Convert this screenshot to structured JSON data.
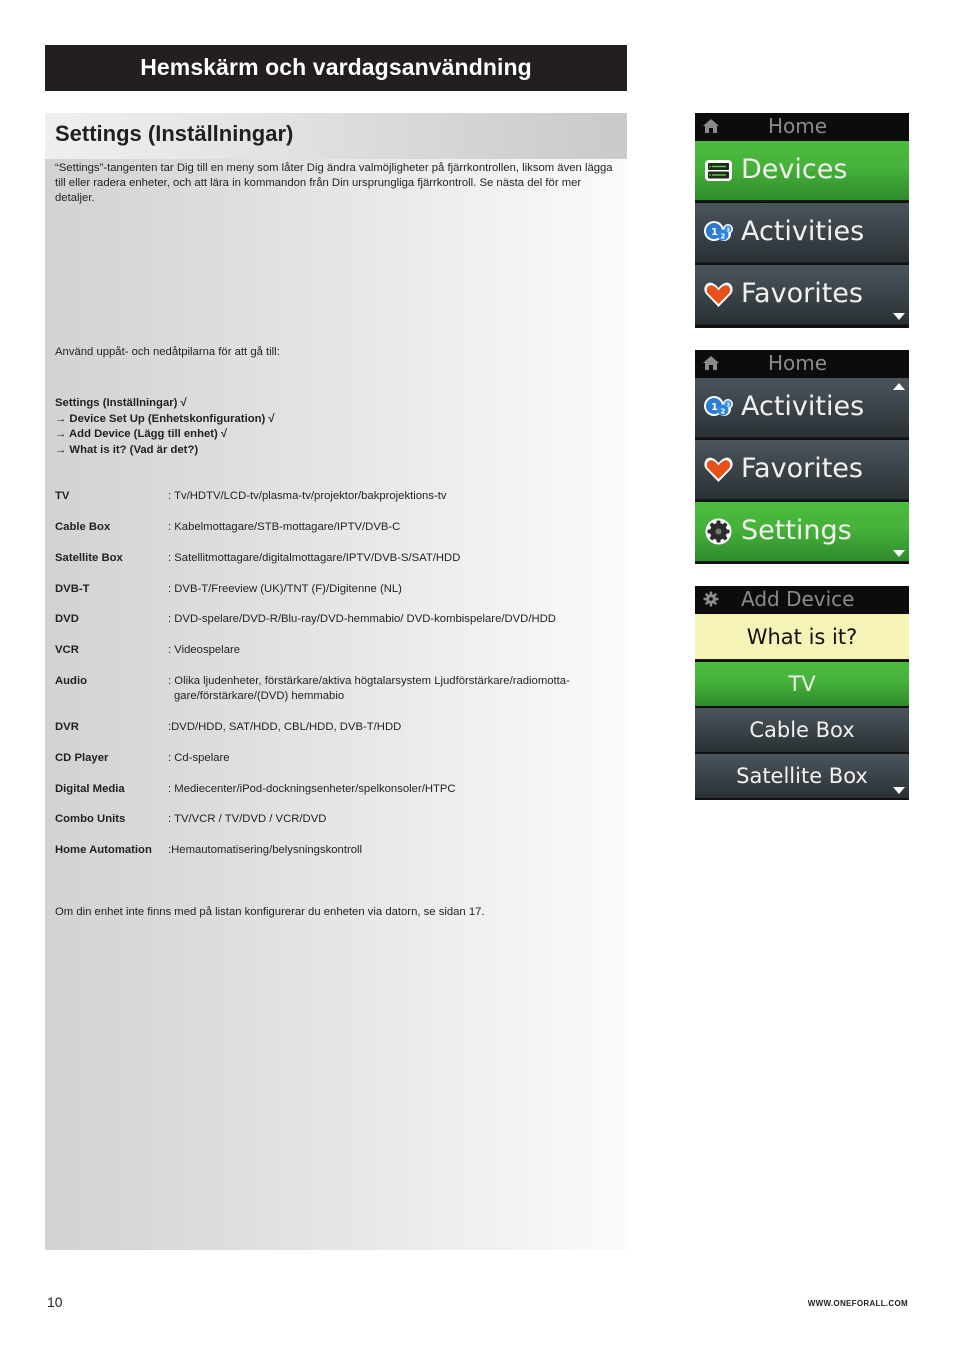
{
  "chapter_title": "Hemskärm och vardagsanvändning",
  "section_title": "Settings (Inställningar)",
  "intro": "“Settings”-tangenten tar Dig till en meny som låter Dig ändra valmöjligheter på fjärrkontrollen, liksom även lägga till eller radera enheter, och att lära in kommandon från Din ursprungliga fjärrkontroll. Se nästa del för mer detaljer.",
  "nav_intro": "Använd uppåt- och nedåtpilarna för att gå till:",
  "menu_path": [
    "Settings (Inställningar) √",
    "→ Device Set Up (Enhetskonfiguration) √",
    "→ Add Device (Lägg till enhet) √",
    "→ What is it? (Vad är det?)"
  ],
  "devices": [
    {
      "name": "TV",
      "desc": ": Tv/HDTV/LCD-tv/plasma-tv/projektor/bakprojektions-tv"
    },
    {
      "name": "Cable Box",
      "desc": ": Kabelmottagare/STB-mottagare/IPTV/DVB-C"
    },
    {
      "name": "Satellite Box",
      "desc": ": Satellitmottagare/digitalmottagare/IPTV/DVB-S/SAT/HDD"
    },
    {
      "name": "DVB-T",
      "desc": ": DVB-T/Freeview (UK)/TNT (F)/Digitenne (NL)"
    },
    {
      "name": "DVD",
      "desc": ": DVD-spelare/DVD-R/Blu-ray/DVD-hemmabio/ DVD-kombispelare/DVD/HDD"
    },
    {
      "name": "VCR",
      "desc": ": Videospelare"
    },
    {
      "name": "Audio",
      "desc": ": Olika ljudenheter, förstärkare/aktiva högtalarsystem Ljudförstärkare/radiomotta-",
      "desc_cont": "gare/förstärkare/(DVD) hemmabio"
    },
    {
      "name": "DVR",
      "desc": ":DVD/HDD, SAT/HDD, CBL/HDD, DVB-T/HDD"
    },
    {
      "name": "CD Player",
      "desc": ": Cd-spelare"
    },
    {
      "name": "Digital Media",
      "desc": ": Mediecenter/iPod-dockningsenheter/spelkonsoler/HTPC"
    },
    {
      "name": "Combo Units",
      "desc": ": TV/VCR / TV/DVD / VCR/DVD"
    },
    {
      "name": "Home Automation",
      "desc": ":Hemautomatisering/belysningskontroll"
    }
  ],
  "footnote": "Om din enhet inte finns med på listan konfigurerar du enheten via datorn, se sidan 17.",
  "page_number": "10",
  "website": "WWW.ONEFORALL.COM",
  "screens": [
    {
      "header_icon": "home-icon",
      "header": "Home",
      "items": [
        {
          "label": "Devices",
          "icon": "devices-icon",
          "selected": true
        },
        {
          "label": "Activities",
          "icon": "activities-icon",
          "selected": false
        },
        {
          "label": "Favorites",
          "icon": "heart-icon",
          "selected": false
        }
      ],
      "scroll_up": false,
      "scroll_down": true
    },
    {
      "header_icon": "home-icon",
      "header": "Home",
      "items": [
        {
          "label": "Activities",
          "icon": "activities-icon",
          "selected": false
        },
        {
          "label": "Favorites",
          "icon": "heart-icon",
          "selected": false
        },
        {
          "label": "Settings",
          "icon": "gear-icon",
          "selected": true
        }
      ],
      "scroll_up": true,
      "scroll_down": true
    },
    {
      "header_icon": "gear-icon",
      "header": "Add Device",
      "prompt": "What is it?",
      "items": [
        {
          "label": "TV",
          "selected": true
        },
        {
          "label": "Cable Box",
          "selected": false
        },
        {
          "label": "Satellite Box",
          "selected": false
        }
      ],
      "scroll_down": true
    }
  ],
  "colors": {
    "selected_green": "#45b23a",
    "item_gray": "#3c454b",
    "prompt_yellow": "#f6f3b7",
    "header_black": "#231f20"
  }
}
